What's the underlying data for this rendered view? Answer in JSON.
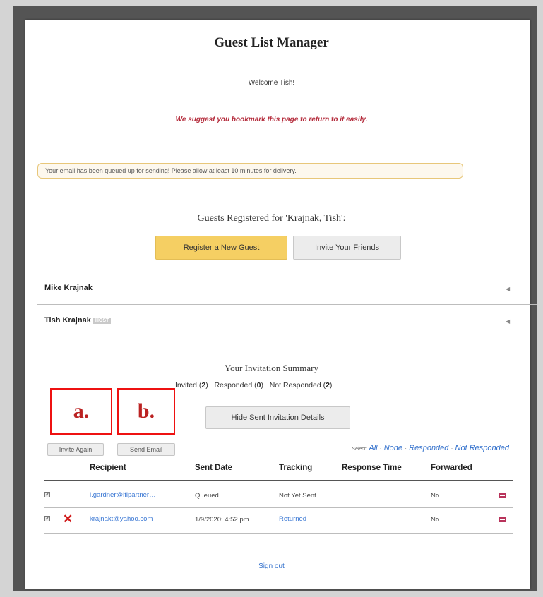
{
  "header": {
    "title": "Guest List Manager",
    "welcome": "Welcome Tish!",
    "bookmark_hint": "We suggest you bookmark this page to return to it easily."
  },
  "notice": "Your email has been queued up for sending! Please allow at least 10 minutes for delivery.",
  "guests_section": {
    "title": "Guests Registered for 'Krajnak, Tish':",
    "register_label": "Register a New Guest",
    "invite_label": "Invite Your Friends",
    "guests": [
      {
        "name": "Mike Krajnak",
        "badge": ""
      },
      {
        "name": "Tish Krajnak",
        "badge": "HOST"
      }
    ]
  },
  "summary": {
    "title": "Your Invitation Summary",
    "invited_label": "Invited",
    "invited_count": "2",
    "responded_label": "Responded",
    "responded_count": "0",
    "not_responded_label": "Not Responded",
    "not_responded_count": "2",
    "hide_details_label": "Hide Sent Invitation Details"
  },
  "annotations": {
    "a": "a.",
    "b": "b."
  },
  "table_actions": {
    "invite_again": "Invite Again",
    "send_email": "Send Email",
    "select_label": "Select:",
    "select_all": "All",
    "select_none": "None",
    "select_responded": "Responded",
    "select_not_responded": "Not Responded"
  },
  "table": {
    "columns": [
      "Recipient",
      "Sent Date",
      "Tracking",
      "Response Time",
      "Forwarded"
    ],
    "rows": [
      {
        "checked": true,
        "error": false,
        "recipient": "l.gardner@ifipartner…",
        "sent_date": "Queued",
        "tracking": "Not Yet Sent",
        "response_time": "",
        "forwarded": "No",
        "flag_icon": "flag-icon"
      },
      {
        "checked": true,
        "error": true,
        "recipient": "krajnakt@yahoo.com",
        "sent_date": "1/9/2020: 4:52 pm",
        "tracking": "Returned",
        "response_time": "",
        "forwarded": "No",
        "flag_icon": "flag-icon"
      }
    ]
  },
  "footer": {
    "signout": "Sign out"
  },
  "colors": {
    "accent_yellow": "#f5cf63",
    "link_blue": "#3b78d4",
    "warning_red": "#b42b3b",
    "annotation_red": "#e11111"
  }
}
